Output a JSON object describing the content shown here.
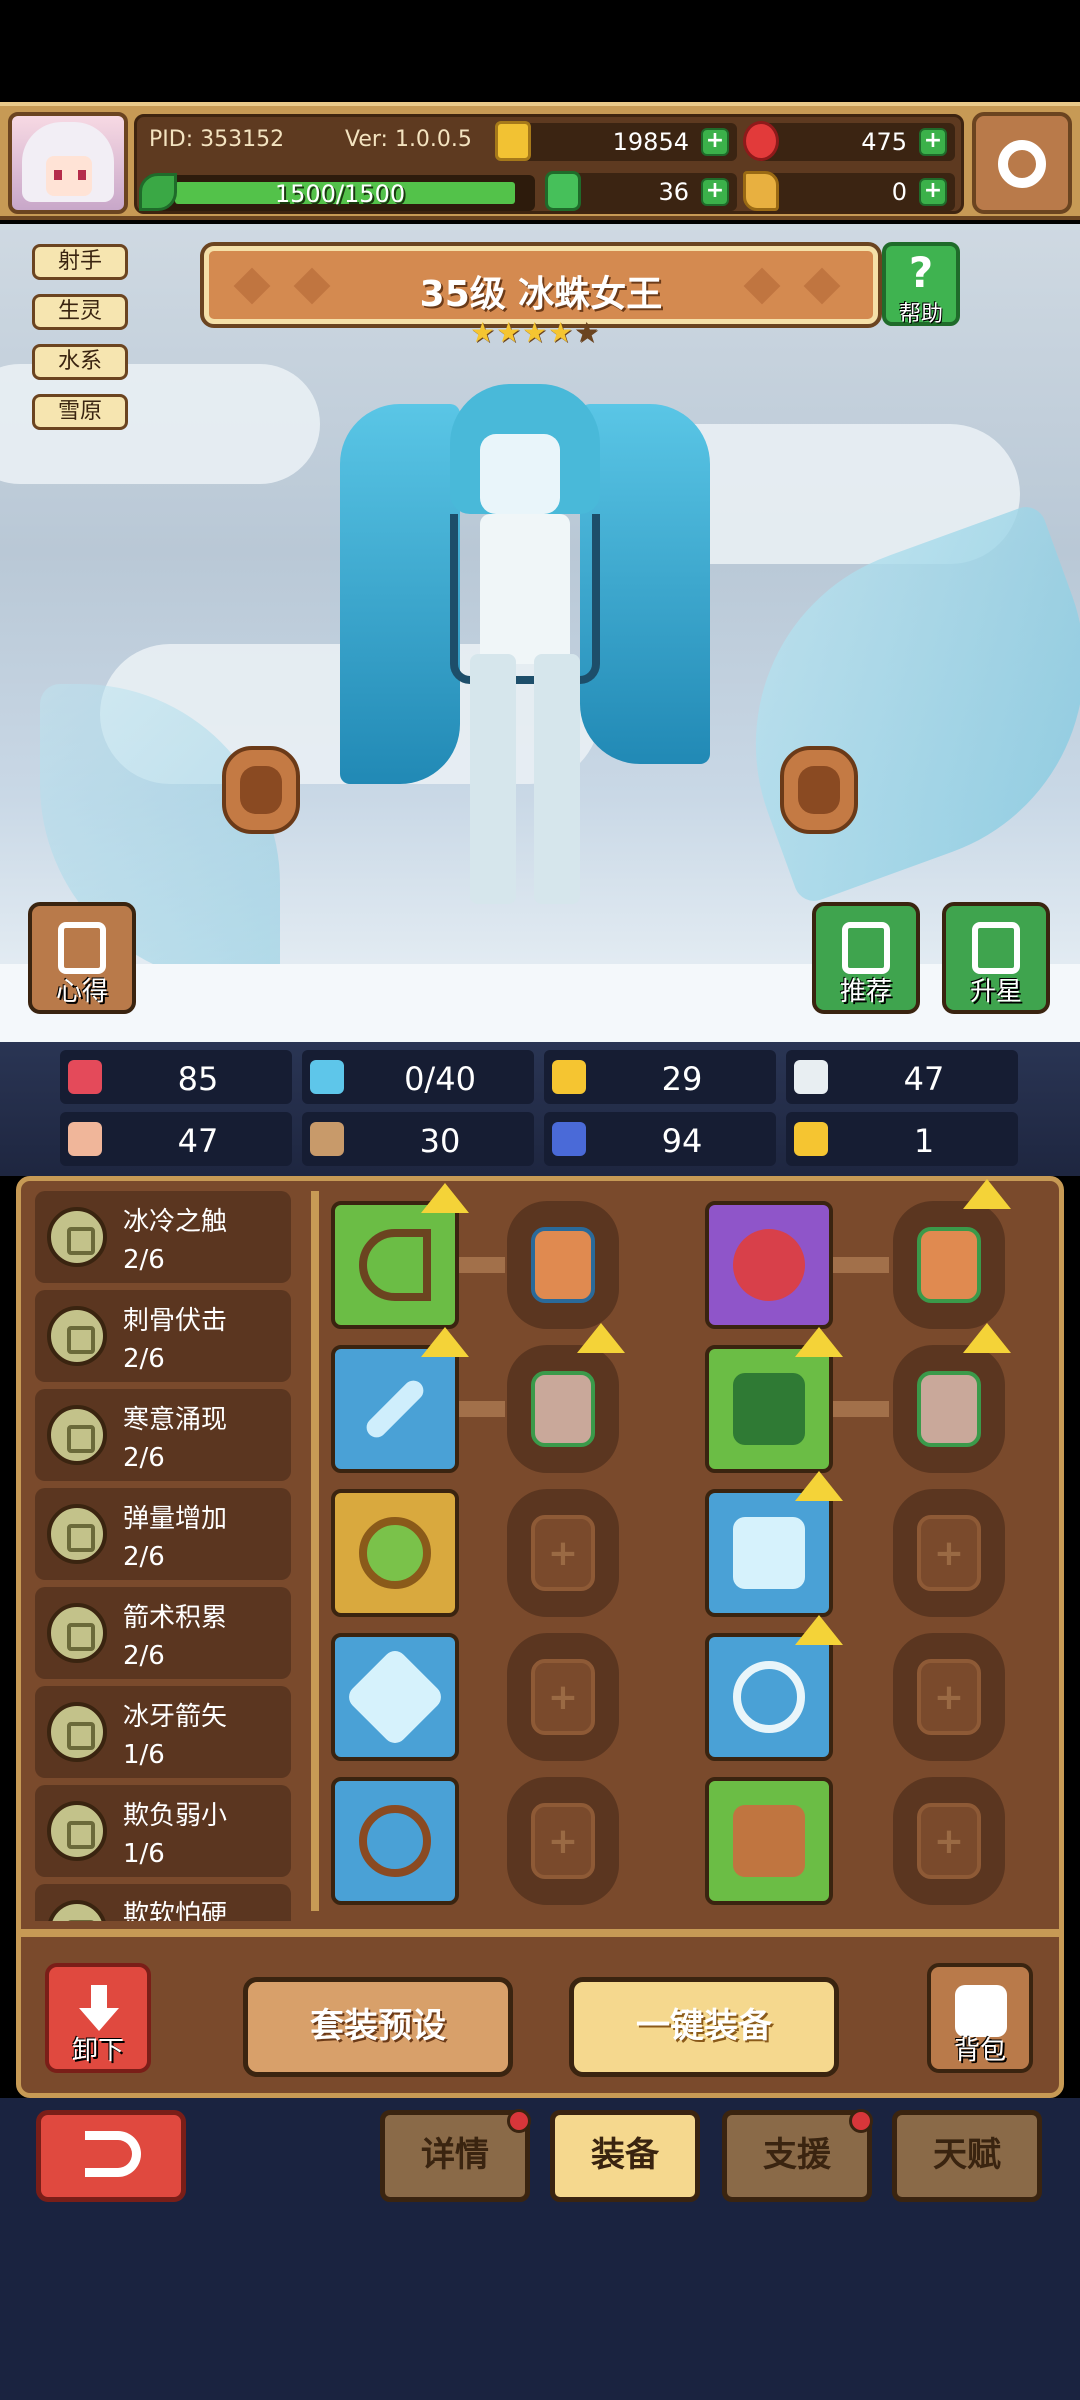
{
  "header": {
    "pid": "PID: 353152",
    "version": "Ver: 1.0.0.5",
    "gold": "19854",
    "gems": "475",
    "clover": "36",
    "keys": "0",
    "energy_text": "1500/1500",
    "energy_fraction": 1.0
  },
  "hero": {
    "tags": [
      "射手",
      "生灵",
      "水系",
      "雪原"
    ],
    "title": "35级 冰蛛女王",
    "stars_filled": 4,
    "stars_total": 5,
    "help_label": "帮助",
    "insight_label": "心得",
    "recommend_label": "推荐",
    "upstar_label": "升星"
  },
  "stats": [
    {
      "icon": "heart-icon",
      "value": "85",
      "color": "#e44a5a"
    },
    {
      "icon": "water-drop-icon",
      "value": "0/40",
      "color": "#5ec6ea"
    },
    {
      "icon": "shield-icon",
      "value": "29",
      "color": "#f5c531"
    },
    {
      "icon": "wing-icon",
      "value": "47",
      "color": "#e8eef2"
    },
    {
      "icon": "fist-icon",
      "value": "47",
      "color": "#f0b69a"
    },
    {
      "icon": "book-icon",
      "value": "30",
      "color": "#c89a6a"
    },
    {
      "icon": "boot-icon",
      "value": "94",
      "color": "#4a6ad8"
    },
    {
      "icon": "magnet-icon",
      "value": "1",
      "color": "#f5c531"
    }
  ],
  "skills": [
    {
      "name": "冰冷之触",
      "level": "2/6"
    },
    {
      "name": "刺骨伏击",
      "level": "2/6"
    },
    {
      "name": "寒意涌现",
      "level": "2/6"
    },
    {
      "name": "弹量增加",
      "level": "2/6"
    },
    {
      "name": "箭术积累",
      "level": "2/6"
    },
    {
      "name": "冰牙箭矢",
      "level": "1/6"
    },
    {
      "name": "欺负弱小",
      "level": "1/6"
    },
    {
      "name": "欺软怕硬",
      "level": ""
    }
  ],
  "equipment": {
    "unload_label": "卸下",
    "preset_label": "套装预设",
    "equip_all_label": "一键装备",
    "bag_label": "背包"
  },
  "nav": {
    "tabs": [
      "详情",
      "装备",
      "支援",
      "天赋"
    ]
  }
}
